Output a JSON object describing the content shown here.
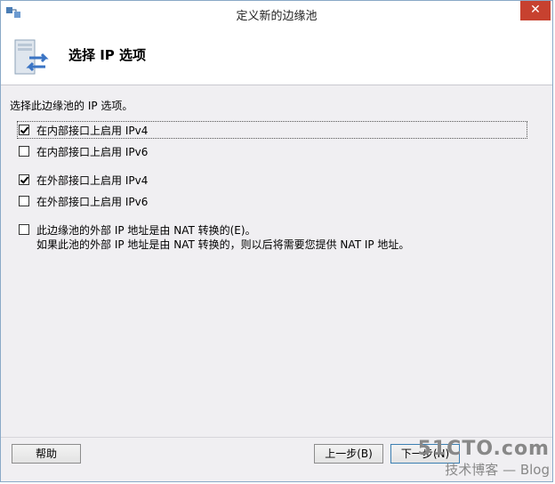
{
  "window": {
    "title": "定义新的边缘池",
    "close_label": "✕"
  },
  "header": {
    "title": "选择 IP 选项"
  },
  "content": {
    "intro": "选择此边缘池的 IP 选项。",
    "options": [
      {
        "label": "在内部接口上启用 IPv4",
        "checked": true
      },
      {
        "label": "在内部接口上启用 IPv6",
        "checked": false
      },
      {
        "label": "在外部接口上启用 IPv4",
        "checked": true
      },
      {
        "label": "在外部接口上启用 IPv6",
        "checked": false
      },
      {
        "label": "此边缘池的外部 IP 地址是由 NAT 转换的(E)。",
        "checked": false
      }
    ],
    "nat_note": "如果此池的外部 IP 地址是由 NAT 转换的，则以后将需要您提供 NAT IP 地址。"
  },
  "buttons": {
    "help": "帮助",
    "back": "上一步(B)",
    "next": "下一步(N)"
  },
  "watermark": {
    "line1": "51CTO.com",
    "line2": "技术博客 — Blog"
  }
}
